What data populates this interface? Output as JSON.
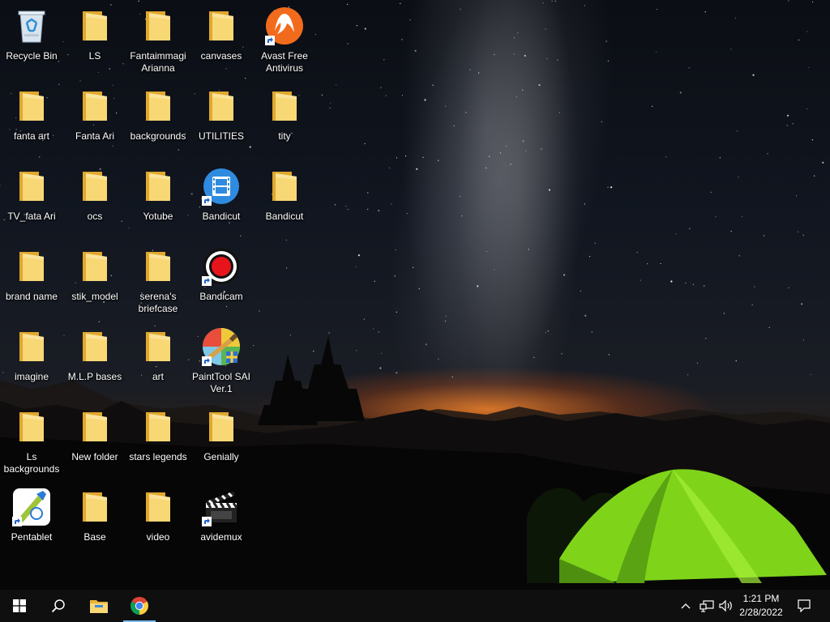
{
  "desktop": {
    "icons": [
      {
        "label": "Recycle Bin",
        "icon": "recycle-bin-icon",
        "shortcut": false
      },
      {
        "label": "LS",
        "icon": "folder-icon",
        "shortcut": false
      },
      {
        "label": "Fantaimmagi Arianna",
        "icon": "folder-icon",
        "shortcut": false
      },
      {
        "label": "canvases",
        "icon": "folder-icon",
        "shortcut": false
      },
      {
        "label": "Avast Free Antivirus",
        "icon": "avast-icon",
        "shortcut": true
      },
      {
        "label": "fanta art",
        "icon": "folder-icon",
        "shortcut": false
      },
      {
        "label": "Fanta Ari",
        "icon": "folder-icon",
        "shortcut": false
      },
      {
        "label": "backgrounds",
        "icon": "folder-icon",
        "shortcut": false
      },
      {
        "label": "UTILITIES",
        "icon": "folder-icon",
        "shortcut": false
      },
      {
        "label": "tity",
        "icon": "folder-icon",
        "shortcut": false
      },
      {
        "label": "TV_fata Ari",
        "icon": "folder-icon",
        "shortcut": false
      },
      {
        "label": "ocs",
        "icon": "folder-icon",
        "shortcut": false
      },
      {
        "label": "Yotube",
        "icon": "folder-icon",
        "shortcut": false
      },
      {
        "label": "Bandicut",
        "icon": "bandicut-icon",
        "shortcut": true
      },
      {
        "label": "Bandicut",
        "icon": "folder-icon",
        "shortcut": false
      },
      {
        "label": "brand name",
        "icon": "folder-icon",
        "shortcut": false
      },
      {
        "label": "stik_model",
        "icon": "folder-icon",
        "shortcut": false
      },
      {
        "label": "serena's briefcase",
        "icon": "folder-icon",
        "shortcut": false
      },
      {
        "label": "Bandicam",
        "icon": "bandicam-icon",
        "shortcut": true
      },
      {
        "label": "imagine",
        "icon": "folder-icon",
        "shortcut": false
      },
      {
        "label": "M.L.P bases",
        "icon": "folder-icon",
        "shortcut": false
      },
      {
        "label": "art",
        "icon": "folder-icon",
        "shortcut": false
      },
      {
        "label": "PaintTool SAI Ver.1",
        "icon": "painttool-sai-icon",
        "shortcut": true
      },
      {
        "label": "Ls backgrounds",
        "icon": "folder-icon",
        "shortcut": false
      },
      {
        "label": "New folder",
        "icon": "folder-icon",
        "shortcut": false
      },
      {
        "label": "stars legends",
        "icon": "folder-icon",
        "shortcut": false
      },
      {
        "label": "Genially",
        "icon": "folder-icon",
        "shortcut": false
      },
      {
        "label": "Pentablet",
        "icon": "pentablet-icon",
        "shortcut": true
      },
      {
        "label": "Base",
        "icon": "folder-icon",
        "shortcut": false
      },
      {
        "label": "video",
        "icon": "folder-icon",
        "shortcut": false
      },
      {
        "label": "avidemux",
        "icon": "avidemux-icon",
        "shortcut": true
      }
    ]
  },
  "taskbar": {
    "start": "windows-start-icon",
    "search": "search-icon",
    "pinned": [
      {
        "name": "file-explorer-icon"
      },
      {
        "name": "chrome-icon",
        "active": true
      }
    ],
    "tray": {
      "overflow": "chevron-up-icon",
      "network": "network-icon",
      "volume": "volume-icon",
      "time": "1:21 PM",
      "date": "2/28/2022",
      "notifications": "action-center-icon"
    }
  },
  "colors": {
    "folder": "#f8d775",
    "taskbar": "#101010",
    "active_indicator": "#76b9ed",
    "tent": "#8fe81c",
    "horizon": "#f5822a"
  }
}
